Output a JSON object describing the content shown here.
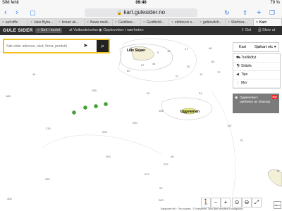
{
  "status": {
    "carrier": "SIM fehlt",
    "time": "09:46",
    "battery": "79 %"
  },
  "browser": {
    "url": "kart.gulesider.no"
  },
  "tabs": [
    "auf offic",
    "Jake Bybe...",
    "ferrari ak...",
    "News medi...",
    "Guidlisre...",
    "Guidfieldi...",
    "elmbruck s...",
    "gebievdch...",
    "Storfosa...",
    "Kart"
  ],
  "site": {
    "logo": "GULE SIDER",
    "nav": [
      "Søk i kartet",
      "Veibeskrivelse",
      "Opplevelser i nærheten"
    ],
    "actions": [
      "Del",
      "Skriv ut"
    ]
  },
  "search": {
    "placeholder": "Søk sider adresse, sted, firma, produkt"
  },
  "map": {
    "type_kart": "Kart",
    "type_other": "Sjøkart etc ▾",
    "layers": [
      "Trafikkflyt",
      "Skiløfs",
      "Tips",
      "Mer"
    ],
    "promo": {
      "text": "Opplevelser i nærheten av Vinterøy",
      "badge": "Ny!"
    },
    "islands": [
      "Lille Skjaer",
      "Uggeleinen"
    ],
    "depths": [
      "18",
      "5",
      "48",
      "27",
      "82",
      "72",
      "30",
      "12",
      "27",
      "20",
      "34",
      "44",
      "82",
      "155",
      "44",
      "57",
      "188",
      "158",
      "200",
      "115",
      "210",
      "200",
      "200",
      "212",
      "237",
      "46",
      "232",
      "23",
      "75",
      "18",
      "400",
      "280"
    ],
    "credits": "Rapporter feil · Om cookies · © Kartverket. Skal ikke benyttes til navigasjon.",
    "scale": "200 m"
  }
}
